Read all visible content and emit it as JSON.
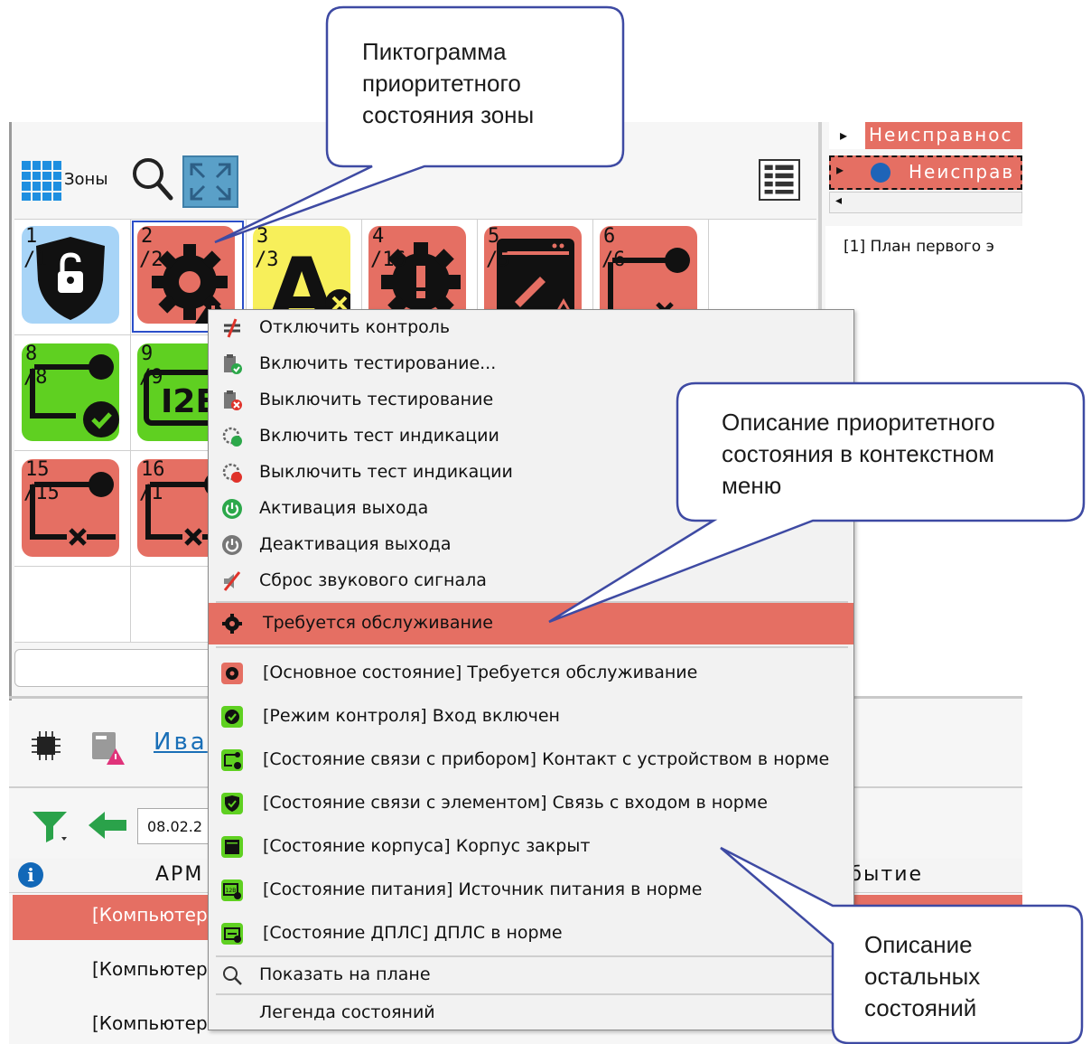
{
  "callouts": {
    "zone_icon": [
      "Пиктограмма",
      "приоритетного",
      "состояния зоны"
    ],
    "menu_desc": [
      "Описание приоритетного",
      "состояния в контекстном",
      "меню"
    ],
    "other_desc": [
      "Описание",
      "остальных",
      "состояний"
    ]
  },
  "toolbar": {
    "zones_label": "Зоны"
  },
  "zones": [
    {
      "num": "1",
      "sub": "/1"
    },
    {
      "num": "2",
      "sub": "/2"
    },
    {
      "num": "3",
      "sub": "/3"
    },
    {
      "num": "4",
      "sub": "/16"
    },
    {
      "num": "5",
      "sub": "/5"
    },
    {
      "num": "6",
      "sub": "/6"
    },
    {
      "num": "8",
      "sub": "/8"
    },
    {
      "num": "9",
      "sub": "/9",
      "text": "I2E"
    },
    {
      "num": "15",
      "sub": "/15"
    },
    {
      "num": "16",
      "sub": "/1"
    }
  ],
  "right_panel": {
    "row1": "Неисправнос",
    "row2": "Неисправ",
    "plan": "[1] План первого э"
  },
  "bottom": {
    "user_link": "Ива",
    "date": "08.02.2",
    "col_arm": "АРМ",
    "col_event": "обытие",
    "rows": [
      "[Компьютер",
      "[Компьютер",
      "[Компьютер"
    ]
  },
  "menu": {
    "actions": [
      {
        "label": "Отключить контроль",
        "icon": "disable-control-icon"
      },
      {
        "label": "Включить тестирование...",
        "icon": "enable-testing-icon"
      },
      {
        "label": "Выключить тестирование",
        "icon": "disable-testing-icon"
      },
      {
        "label": "Включить тест индикации",
        "icon": "enable-indication-test-icon"
      },
      {
        "label": "Выключить тест индикации",
        "icon": "disable-indication-test-icon"
      },
      {
        "label": "Активация выхода",
        "icon": "output-activate-icon"
      },
      {
        "label": "Деактивация выхода",
        "icon": "output-deactivate-icon"
      },
      {
        "label": "Сброс звукового сигнала",
        "icon": "sound-reset-icon"
      }
    ],
    "priority_state": "Требуется обслуживание",
    "states": [
      "[Основное состояние] Требуется обслуживание",
      "[Режим контроля] Вход включен",
      "[Состояние связи с прибором] Контакт с устройством в норме",
      "[Состояние связи с элементом] Связь с входом в норме",
      "[Состояние корпуса] Корпус закрыт",
      "[Состояние питания] Источник питания в норме",
      "[Состояние ДПЛС] ДПЛС в норме"
    ],
    "show_on_plan": "Показать на плане",
    "legend": "Легенда состояний"
  },
  "colors": {
    "alarm_red": "#e56f63",
    "ok_green": "#5fd021",
    "warning_yellow": "#f7ef5a",
    "normal_blue": "#a7d4f7",
    "link_blue": "#1a6fb7"
  }
}
